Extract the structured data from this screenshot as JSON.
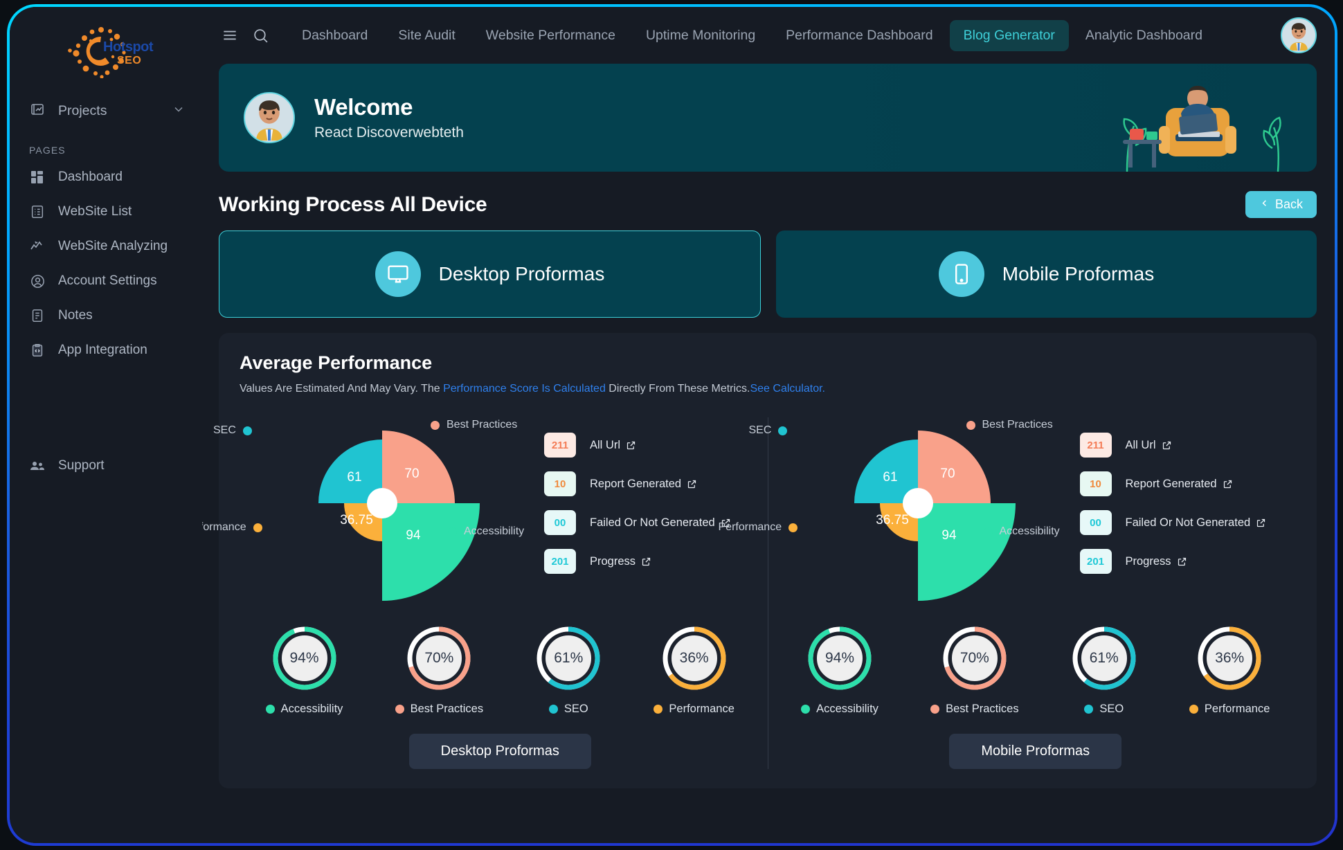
{
  "brand": {
    "name": "Hotspot",
    "sub": "SEO",
    "icon": "sun-dots-logo"
  },
  "sidebar": {
    "projects": {
      "label": "Projects",
      "icon": "projects-icon",
      "chevron": "chevron-down-icon"
    },
    "section_label": "PAGES",
    "items": [
      {
        "label": "Dashboard",
        "icon": "dashboard-grid-icon"
      },
      {
        "label": "WebSite List",
        "icon": "list-icon"
      },
      {
        "label": "WebSite Analyzing",
        "icon": "analytics-line-icon"
      },
      {
        "label": "Account Settings",
        "icon": "user-circle-icon"
      },
      {
        "label": "Notes",
        "icon": "notes-icon"
      },
      {
        "label": "App Integration",
        "icon": "code-clipboard-icon"
      }
    ],
    "support": {
      "label": "Support",
      "icon": "support-people-icon"
    }
  },
  "topbar": {
    "menu_icon": "hamburger-menu-icon",
    "search_icon": "search-icon",
    "avatar_icon": "user-avatar",
    "tabs": [
      {
        "label": "Dashboard",
        "active": false
      },
      {
        "label": "Site Audit",
        "active": false
      },
      {
        "label": "Website Performance",
        "active": false
      },
      {
        "label": "Uptime Monitoring",
        "active": false
      },
      {
        "label": "Performance Dashboard",
        "active": false
      },
      {
        "label": "Blog Generator",
        "active": true
      },
      {
        "label": "Analytic Dashboard",
        "active": false
      }
    ]
  },
  "welcome": {
    "title": "Welcome",
    "subtitle": "React Discoverwebteth",
    "avatar_icon": "user-avatar"
  },
  "page": {
    "title": "Working Process All Device",
    "back_label": "Back",
    "back_icon": "chevron-left-icon"
  },
  "proformas": [
    {
      "label": "Desktop Proformas",
      "icon": "desktop-monitor-icon",
      "selected": true
    },
    {
      "label": "Mobile Proformas",
      "icon": "mobile-phone-icon",
      "selected": false
    }
  ],
  "performance": {
    "title": "Average Performance",
    "note_prefix": "Values Are Estimated And May Vary. The ",
    "note_link1": "Performance Score Is Calculated",
    "note_middle": " Directly From These Metrics.",
    "note_link2": "See Calculator."
  },
  "colors": {
    "best_practices": "#f9a18a",
    "accessibility": "#2ddfab",
    "seo": "#20c4d1",
    "performance": "#fbb03b",
    "accent": "#4ec8dd",
    "active_tab_bg": "#114048",
    "active_tab_text": "#3ecfd8",
    "panel_bg": "#1b212c",
    "banner_bg": "#04414f",
    "link": "#2f80ed"
  },
  "chart_data": [
    {
      "type": "pie",
      "title": "Desktop Proformas Average Performance",
      "variant": "nightingale-rose",
      "legend_position": "around",
      "slices": [
        {
          "name": "Best Practices",
          "value": 70,
          "color": "#f9a18a",
          "quadrant": "top-right"
        },
        {
          "name": "Accessibility",
          "value": 94,
          "color": "#2ddfab",
          "quadrant": "bottom-right"
        },
        {
          "name": "Performance",
          "value": 36.75,
          "color": "#fbb03b",
          "quadrant": "bottom-left"
        },
        {
          "name": "SEC",
          "value": 61,
          "color": "#20c4d1",
          "quadrant": "top-left"
        }
      ],
      "max": 100,
      "stats": [
        {
          "value": "211",
          "label": "All Url",
          "badge_bg": "#fdeae4",
          "badge_fg": "#f47b55",
          "icon": "external-link-icon"
        },
        {
          "value": "10",
          "label": "Report Generated",
          "badge_bg": "#e7f8f2",
          "badge_fg": "#f08a3c",
          "icon": "external-link-icon"
        },
        {
          "value": "00",
          "label": "Failed Or Not Generated",
          "badge_bg": "#e7f8f8",
          "badge_fg": "#1ec8d6",
          "icon": "external-link-icon"
        },
        {
          "value": "201",
          "label": "Progress",
          "badge_bg": "#e7f8f8",
          "badge_fg": "#1ec8d6",
          "icon": "external-link-icon"
        }
      ],
      "gauges": [
        {
          "label": "Accessibility",
          "value": 94,
          "display": "94%",
          "color": "#2ddfab"
        },
        {
          "label": "Best Practices",
          "value": 70,
          "display": "70%",
          "color": "#f9a18a"
        },
        {
          "label": "SEO",
          "value": 61,
          "display": "61%",
          "color": "#20c4d1"
        },
        {
          "label": "Performance",
          "value": 36,
          "display": "36%",
          "color": "#fbb03b"
        }
      ],
      "footer_button": "Desktop Proformas"
    },
    {
      "type": "pie",
      "title": "Mobile Proformas Average Performance",
      "variant": "nightingale-rose",
      "legend_position": "around",
      "slices": [
        {
          "name": "Best Practices",
          "value": 70,
          "color": "#f9a18a",
          "quadrant": "top-right"
        },
        {
          "name": "Accessibility",
          "value": 94,
          "color": "#2ddfab",
          "quadrant": "bottom-right"
        },
        {
          "name": "Performance",
          "value": 36.75,
          "color": "#fbb03b",
          "quadrant": "bottom-left"
        },
        {
          "name": "SEC",
          "value": 61,
          "color": "#20c4d1",
          "quadrant": "top-left"
        }
      ],
      "max": 100,
      "stats": [
        {
          "value": "211",
          "label": "All Url",
          "badge_bg": "#fdeae4",
          "badge_fg": "#f47b55",
          "icon": "external-link-icon"
        },
        {
          "value": "10",
          "label": "Report Generated",
          "badge_bg": "#e7f8f2",
          "badge_fg": "#f08a3c",
          "icon": "external-link-icon"
        },
        {
          "value": "00",
          "label": "Failed Or Not Generated",
          "badge_bg": "#e7f8f8",
          "badge_fg": "#1ec8d6",
          "icon": "external-link-icon"
        },
        {
          "value": "201",
          "label": "Progress",
          "badge_bg": "#e7f8f8",
          "badge_fg": "#1ec8d6",
          "icon": "external-link-icon"
        }
      ],
      "gauges": [
        {
          "label": "Accessibility",
          "value": 94,
          "display": "94%",
          "color": "#2ddfab"
        },
        {
          "label": "Best Practices",
          "value": 70,
          "display": "70%",
          "color": "#f9a18a"
        },
        {
          "label": "SEO",
          "value": 61,
          "display": "61%",
          "color": "#20c4d1"
        },
        {
          "label": "Performance",
          "value": 36,
          "display": "36%",
          "color": "#fbb03b"
        }
      ],
      "footer_button": "Mobile Proformas"
    }
  ]
}
